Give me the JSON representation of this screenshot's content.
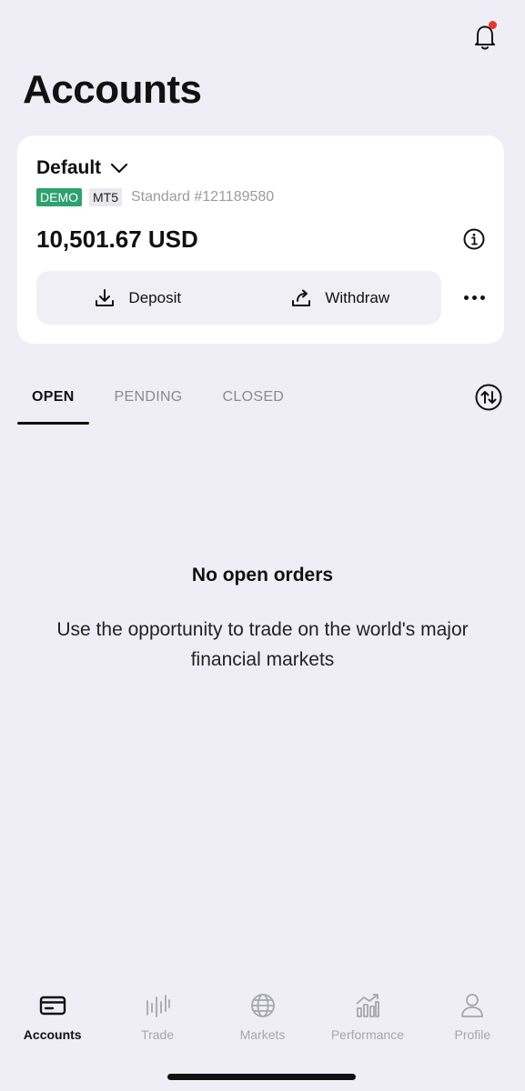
{
  "page": {
    "title": "Accounts"
  },
  "account": {
    "name": "Default",
    "badge_demo": "DEMO",
    "badge_platform": "MT5",
    "type_number": "Standard #121189580",
    "balance": "10,501.67 USD",
    "deposit_label": "Deposit",
    "withdraw_label": "Withdraw"
  },
  "tabs": [
    {
      "label": "OPEN",
      "active": true
    },
    {
      "label": "PENDING",
      "active": false
    },
    {
      "label": "CLOSED",
      "active": false
    }
  ],
  "empty_state": {
    "title": "No open orders",
    "message": "Use the opportunity to trade on the world's major financial markets"
  },
  "bottom_nav": [
    {
      "label": "Accounts",
      "icon": "wallet-icon",
      "active": true
    },
    {
      "label": "Trade",
      "icon": "candles-icon",
      "active": false
    },
    {
      "label": "Markets",
      "icon": "globe-icon",
      "active": false
    },
    {
      "label": "Performance",
      "icon": "chart-icon",
      "active": false
    },
    {
      "label": "Profile",
      "icon": "person-icon",
      "active": false
    }
  ],
  "colors": {
    "background": "#efeef6",
    "demo_badge": "#2fa16e",
    "notification_dot": "#e5382f",
    "inactive_text": "#a6a6ae"
  }
}
